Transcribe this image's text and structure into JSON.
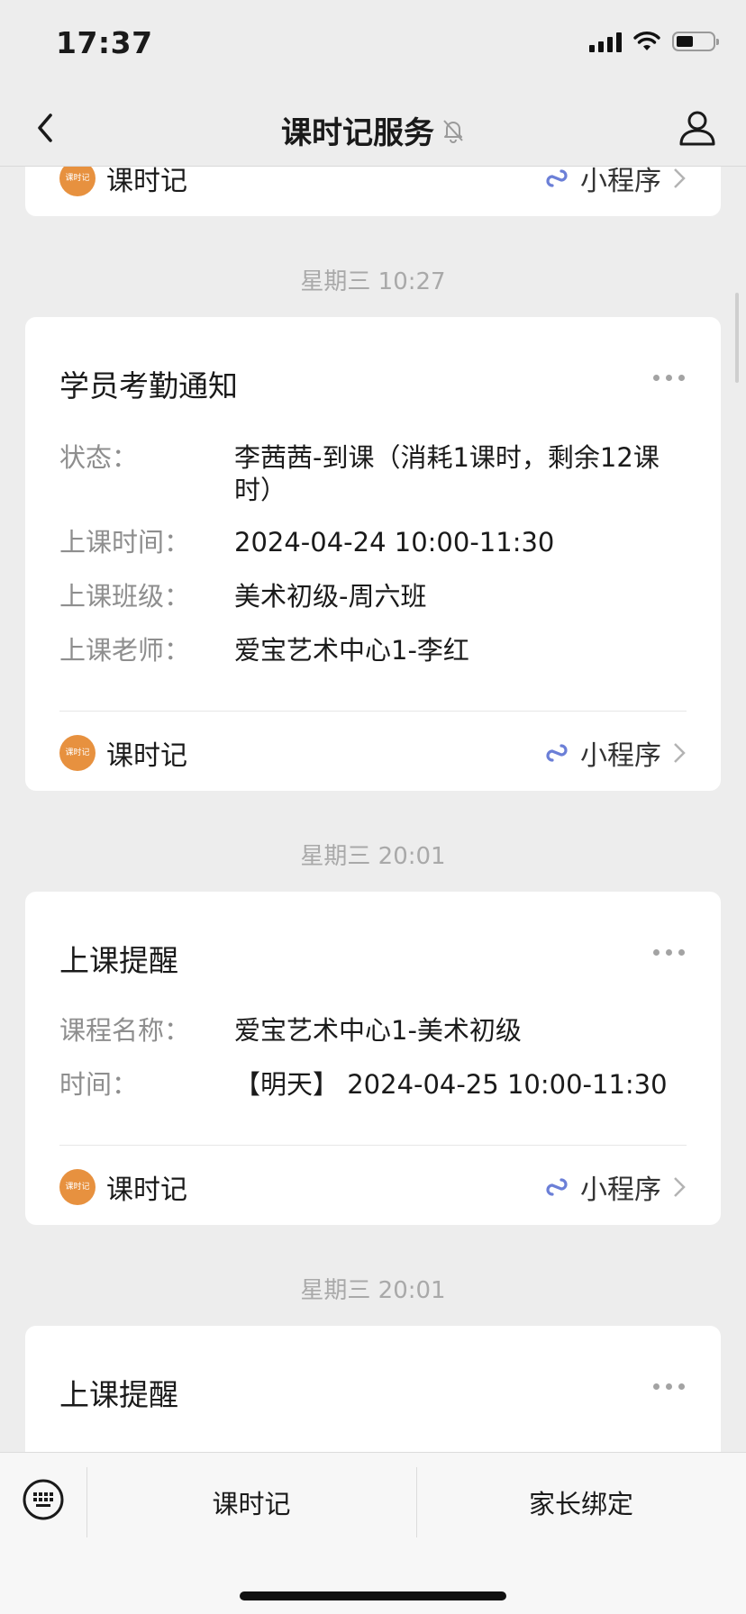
{
  "status_bar": {
    "time": "17:37"
  },
  "nav": {
    "title": "课时记服务"
  },
  "app": {
    "name": "课时记",
    "avatar_text": "课时记",
    "mini_label": "小程序"
  },
  "messages": [
    {
      "timestamp": "星期三 10:27",
      "title": "学员考勤通知",
      "rows": [
        {
          "label": "状态：",
          "value": "李茜茜-到课（消耗1课时，剩余12课时）"
        },
        {
          "label": "上课时间：",
          "value": "2024-04-24 10:00-11:30"
        },
        {
          "label": "上课班级：",
          "value": "美术初级-周六班"
        },
        {
          "label": "上课老师：",
          "value": "爱宝艺术中心1-李红"
        }
      ]
    },
    {
      "timestamp": "星期三 20:01",
      "title": "上课提醒",
      "rows": [
        {
          "label": "课程名称：",
          "value": "爱宝艺术中心1-美术初级"
        },
        {
          "label": "时间：",
          "value": "【明天】 2024-04-25 10:00-11:30"
        }
      ]
    },
    {
      "timestamp": "星期三 20:01",
      "title": "上课提醒",
      "rows": []
    }
  ],
  "bottom_menu": {
    "item1": "课时记",
    "item2": "家长绑定"
  },
  "colors": {
    "background": "#ededed",
    "card": "#ffffff",
    "app_avatar": "#e7913f",
    "mini_icon": "#6b7fd7"
  }
}
